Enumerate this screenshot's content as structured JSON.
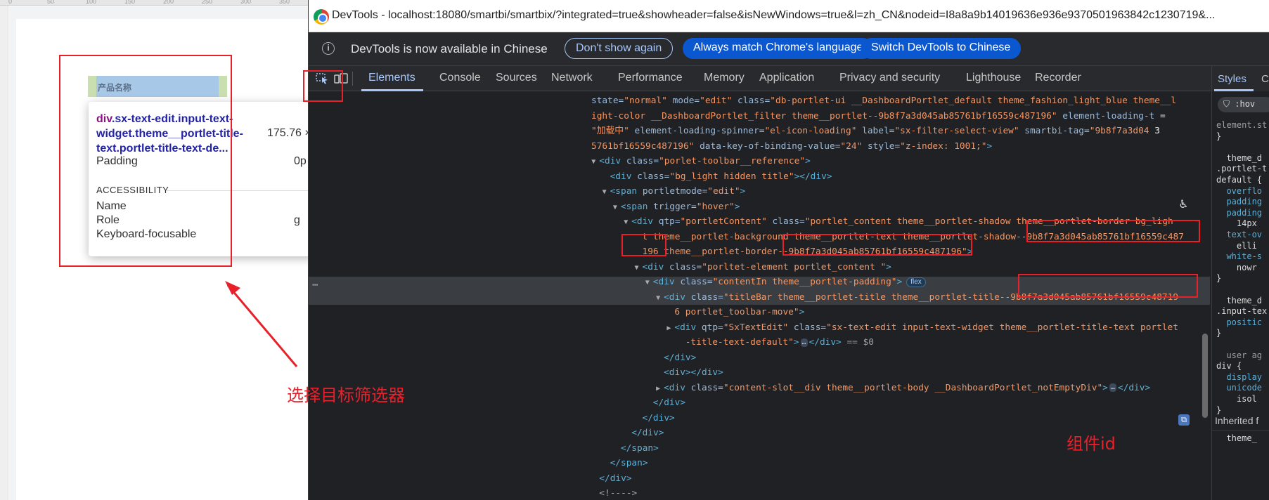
{
  "canvas": {
    "ruler_marks": [
      "0",
      "50",
      "100",
      "150",
      "200",
      "250",
      "300",
      "350"
    ],
    "widget_title": "产品名称"
  },
  "tooltip": {
    "selector_tag": "div",
    "selector_rest": ".sx-text-edit.input-text-widget.theme__portlet-title-text.portlet-title-text-de...",
    "size": "175.76 ×",
    "rows": [
      {
        "label": "Padding",
        "value": "0p"
      },
      {
        "label": "Name",
        "value": ""
      },
      {
        "label": "Role",
        "value": "g"
      },
      {
        "label": "Keyboard-focusable",
        "value": ""
      }
    ],
    "section": "ACCESSIBILITY"
  },
  "annotations": {
    "select_target": "选择目标筛选器",
    "component_id": "组件id",
    "color": "#e8202a"
  },
  "devtools": {
    "window_title": "DevTools - localhost:18080/smartbi/smartbix/?integrated=true&showheader=false&isNewWindows=true&l=zh_CN&nodeid=I8a8a9b14019636e936e9370501963842c1230719&...",
    "info_icon": "info-icon",
    "info_text": "DevTools is now available in Chinese",
    "buttons": {
      "dont_show": "Don't show again",
      "always_match": "Always match Chrome's language",
      "switch": "Switch DevTools to Chinese"
    },
    "tabs": [
      "Elements",
      "Console",
      "Sources",
      "Network",
      "Performance",
      "Memory",
      "Application",
      "Privacy and security",
      "Lighthouse",
      "Recorder"
    ],
    "active_tab": "Elements",
    "code_lines": [
      {
        "indent": 0,
        "tri": "",
        "html": [
          [
            "a",
            "state="
          ],
          [
            "v",
            "\"normal\""
          ],
          [
            "a",
            " mode="
          ],
          [
            "v",
            "\"edit\""
          ],
          [
            "a",
            " class="
          ],
          [
            "v",
            "\"db-portlet-ui __DashboardPortlet_default theme_fashion_light_blue theme__l"
          ]
        ]
      },
      {
        "indent": 0,
        "tri": "",
        "html": [
          [
            "v",
            "ight-color __DashboardPortlet_filter theme__portlet--9b8f7a3d045ab85761bf16559c487196\""
          ],
          [
            "a",
            " element-loading-t"
          ],
          [
            "w",
            " ="
          ]
        ]
      },
      {
        "indent": 0,
        "tri": "",
        "html": [
          [
            "v",
            "\"加载中\""
          ],
          [
            "a",
            " element-loading-spinner="
          ],
          [
            "v",
            "\"el-icon-loading\""
          ],
          [
            "a",
            " label="
          ],
          [
            "v",
            "\"sx-filter-select-view\""
          ],
          [
            "a",
            " smartbi-tag="
          ],
          [
            "v",
            "\"9b8f7a3d04"
          ],
          [
            "w",
            " 3"
          ]
        ]
      },
      {
        "indent": 0,
        "tri": "",
        "html": [
          [
            "v",
            "5761bf16559c487196\""
          ],
          [
            "a",
            " data-key-of-binding-value="
          ],
          [
            "v",
            "\"24\""
          ],
          [
            "a",
            " style="
          ],
          [
            "v",
            "\"z-index: 1001;\""
          ],
          [
            "t",
            ">"
          ]
        ]
      },
      {
        "indent": 1,
        "tri": "▼",
        "html": [
          [
            "t",
            "<div"
          ],
          [
            "a",
            " class="
          ],
          [
            "v",
            "\"porlet-toolbar__reference\""
          ],
          [
            "t",
            ">"
          ]
        ]
      },
      {
        "indent": 2,
        "tri": "",
        "html": [
          [
            "t",
            "<div"
          ],
          [
            "a",
            " class="
          ],
          [
            "v",
            "\"bg_light hidden title\""
          ],
          [
            "t",
            "></div>"
          ]
        ]
      },
      {
        "indent": 2,
        "tri": "▼",
        "html": [
          [
            "t",
            "<span"
          ],
          [
            "a",
            " portletmode="
          ],
          [
            "v",
            "\"edit\""
          ],
          [
            "t",
            ">"
          ]
        ]
      },
      {
        "indent": 3,
        "tri": "▼",
        "html": [
          [
            "t",
            "<span"
          ],
          [
            "a",
            " trigger="
          ],
          [
            "v",
            "\"hover\""
          ],
          [
            "t",
            ">"
          ]
        ]
      },
      {
        "indent": 4,
        "tri": "▼",
        "html": [
          [
            "t",
            "<div"
          ],
          [
            "a",
            " qtp="
          ],
          [
            "v",
            "\"portletContent\""
          ],
          [
            "a",
            " class="
          ],
          [
            "v",
            "\"portlet_content theme__portlet-shadow theme__portlet-border bg_ligh"
          ]
        ]
      },
      {
        "indent": 5,
        "tri": "",
        "html": [
          [
            "v",
            "t theme__portlet-background theme__portlet-text theme__portlet-shadow--9b8f7a3d045ab85761bf16559c487"
          ]
        ]
      },
      {
        "indent": 5,
        "tri": "",
        "html": [
          [
            "v",
            "196 theme__portlet-border--9b8f7a3d045ab85761bf16559c487196\""
          ],
          [
            "t",
            ">"
          ]
        ]
      },
      {
        "indent": 5,
        "tri": "▼",
        "html": [
          [
            "t",
            "<div"
          ],
          [
            "a",
            " class="
          ],
          [
            "v",
            "\"porltet-element portlet_content \""
          ],
          [
            "t",
            ">"
          ]
        ]
      },
      {
        "indent": 6,
        "tri": "▼",
        "html": [
          [
            "t",
            "<div"
          ],
          [
            "a",
            " class="
          ],
          [
            "v",
            "\"contentIn theme__portlet-padding\""
          ],
          [
            "t",
            ">"
          ],
          [
            "badge",
            "flex"
          ]
        ]
      },
      {
        "indent": 7,
        "tri": "▼",
        "html": [
          [
            "t",
            "<div"
          ],
          [
            "a",
            " class="
          ],
          [
            "v",
            "\"titleBar theme__portlet-title theme__portlet-title--9b8f7a3d045ab85761bf16559c48719"
          ]
        ]
      },
      {
        "indent": 8,
        "tri": "",
        "html": [
          [
            "v",
            "6 portlet_toolbar-move\""
          ],
          [
            "t",
            ">"
          ]
        ]
      },
      {
        "indent": 8,
        "tri": "▶",
        "html": [
          [
            "t",
            "<div"
          ],
          [
            "a",
            " qtp="
          ],
          [
            "v",
            "\"SxTextEdit\""
          ],
          [
            "a",
            " class="
          ],
          [
            "v",
            "\"sx-text-edit input-text-widget theme__portlet-title-text portlet"
          ]
        ]
      },
      {
        "indent": 9,
        "tri": "",
        "html": [
          [
            "v",
            "-title-text-default\""
          ],
          [
            "t",
            ">"
          ],
          [
            "dots",
            "…"
          ],
          [
            "t",
            "</div>"
          ],
          [
            "eq",
            " == $0"
          ]
        ]
      },
      {
        "indent": 7,
        "tri": "",
        "html": [
          [
            "t",
            "</div>"
          ]
        ]
      },
      {
        "indent": 7,
        "tri": "",
        "html": [
          [
            "t",
            "<div></div>"
          ]
        ]
      },
      {
        "indent": 7,
        "tri": "▶",
        "html": [
          [
            "t",
            "<div"
          ],
          [
            "a",
            " class="
          ],
          [
            "v",
            "\"content-slot__div theme__portlet-body __DashboardPortlet_notEmptyDiv\""
          ],
          [
            "t",
            ">"
          ],
          [
            "dots",
            "…"
          ],
          [
            "t",
            "</div>"
          ]
        ]
      },
      {
        "indent": 6,
        "tri": "",
        "html": [
          [
            "t",
            "</div>"
          ]
        ]
      },
      {
        "indent": 5,
        "tri": "",
        "html": [
          [
            "t",
            "</div>"
          ]
        ]
      },
      {
        "indent": 4,
        "tri": "",
        "html": [
          [
            "t",
            "</div>"
          ]
        ]
      },
      {
        "indent": 3,
        "tri": "",
        "html": [
          [
            "t",
            "</span>"
          ]
        ]
      },
      {
        "indent": 2,
        "tri": "",
        "html": [
          [
            "t",
            "</span>"
          ]
        ]
      },
      {
        "indent": 1,
        "tri": "",
        "html": [
          [
            "t",
            "</div>"
          ]
        ]
      },
      {
        "indent": 1,
        "tri": "",
        "html": [
          [
            "p",
            "<!---->"
          ]
        ]
      },
      {
        "indent": 1,
        "tri": "",
        "html": [
          [
            "p",
            "<!---->"
          ]
        ]
      }
    ],
    "styles_tab": "Styles",
    "styles_tab2": "C",
    "styles_filter": ":hov",
    "styles_lines": [
      {
        "text": "element.st",
        "c": "#9aa0a6"
      },
      {
        "text": "}",
        "c": "#ddd"
      },
      {
        "text": "",
        "c": "#ddd"
      },
      {
        "text": "  theme_d",
        "c": "#ddd"
      },
      {
        "text": ".portlet-t",
        "c": "#ddd"
      },
      {
        "text": "default {",
        "c": "#ddd"
      },
      {
        "text": "  overflo",
        "c": "#5db0d7"
      },
      {
        "text": "  padding",
        "c": "#5db0d7"
      },
      {
        "text": "  padding",
        "c": "#5db0d7"
      },
      {
        "text": "    14px",
        "c": "#ddd"
      },
      {
        "text": "  text-ov",
        "c": "#5db0d7"
      },
      {
        "text": "    elli",
        "c": "#ddd"
      },
      {
        "text": "  white-s",
        "c": "#5db0d7"
      },
      {
        "text": "    nowr",
        "c": "#ddd"
      },
      {
        "text": "}",
        "c": "#ddd"
      },
      {
        "text": "",
        "c": "#ddd"
      },
      {
        "text": "  theme_d",
        "c": "#ddd"
      },
      {
        "text": ".input-tex",
        "c": "#ddd"
      },
      {
        "text": "  positic",
        "c": "#5db0d7"
      },
      {
        "text": "}",
        "c": "#ddd"
      },
      {
        "text": "",
        "c": "#ddd"
      },
      {
        "text": "  user ag",
        "c": "#9aa0a6"
      },
      {
        "text": "div {",
        "c": "#ddd"
      },
      {
        "text": "  display",
        "c": "#5db0d7"
      },
      {
        "text": "  unicode",
        "c": "#5db0d7"
      },
      {
        "text": "    isol",
        "c": "#ddd"
      },
      {
        "text": "}",
        "c": "#ddd"
      }
    ],
    "inherited": "Inherited f",
    "styles_last": "  theme_"
  }
}
